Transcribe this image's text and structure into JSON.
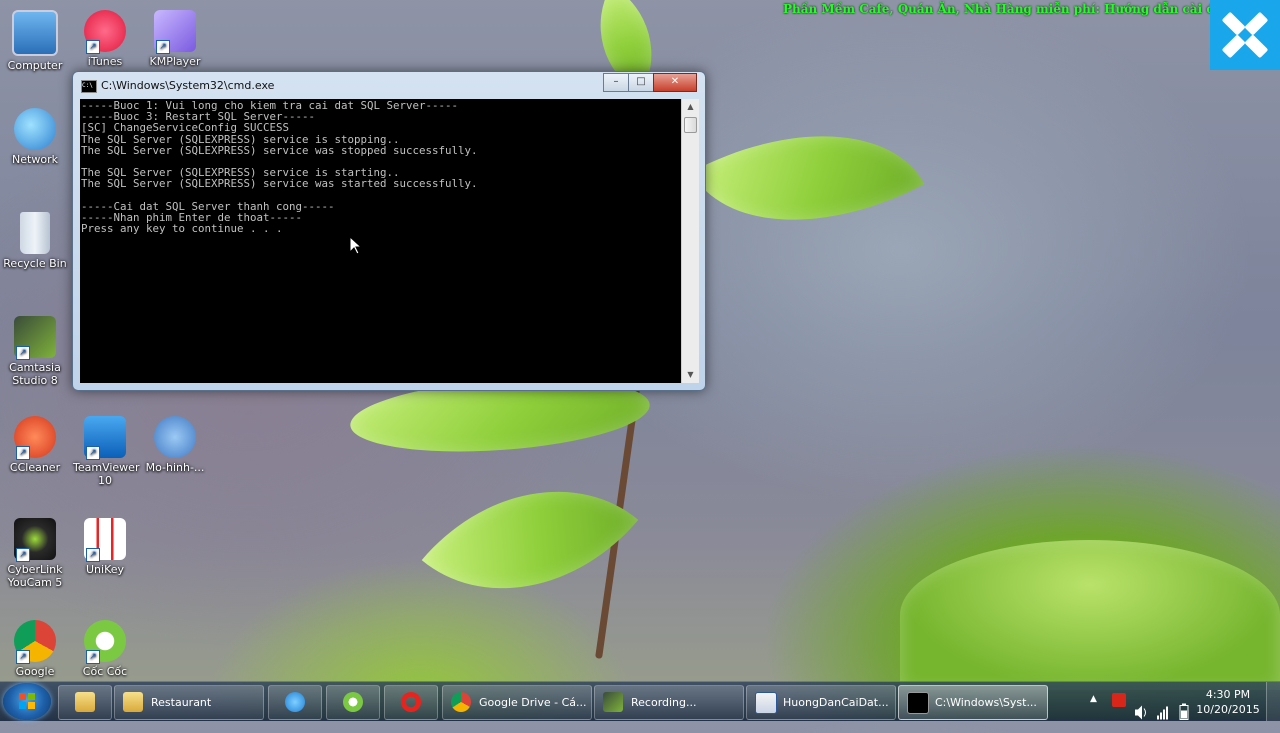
{
  "banner": {
    "text": "Phần Mềm Cafe, Quán Ăn, Nhà Hàng miễn phí: Hướng dẫn cài đặt p"
  },
  "desktop_icons": [
    {
      "label": "Computer"
    },
    {
      "label": "iTunes"
    },
    {
      "label": "KMPlayer"
    },
    {
      "label": "Network"
    },
    {
      "label": "Recycle Bin"
    },
    {
      "label": "Camtasia Studio 8"
    },
    {
      "label": "CCleaner"
    },
    {
      "label": "TeamViewer 10"
    },
    {
      "label": "Mo-hinh-..."
    },
    {
      "label": "CyberLink YouCam 5"
    },
    {
      "label": "UniKey"
    },
    {
      "label": "Google"
    },
    {
      "label": "Cốc Cốc"
    }
  ],
  "cmd_window": {
    "title": "C:\\Windows\\System32\\cmd.exe",
    "icon_text": "C:\\",
    "controls": {
      "minimize": "–",
      "maximize": "□",
      "close": "✕"
    },
    "console_lines": [
      "-----Buoc 1: Vui long cho kiem tra cai dat SQL Server-----",
      "-----Buoc 3: Restart SQL Server-----",
      "[SC] ChangeServiceConfig SUCCESS",
      "The SQL Server (SQLEXPRESS) service is stopping..",
      "The SQL Server (SQLEXPRESS) service was stopped successfully.",
      "",
      "The SQL Server (SQLEXPRESS) service is starting..",
      "The SQL Server (SQLEXPRESS) service was started successfully.",
      "",
      "-----Cai dat SQL Server thanh cong-----",
      "-----Nhan phim Enter de thoat-----",
      "Press any key to continue . . ."
    ],
    "scroll_up": "▲",
    "scroll_down": "▼"
  },
  "taskbar": {
    "buttons": [
      {
        "label": "Restaurant"
      },
      {
        "label": "Google Drive - Cá..."
      },
      {
        "label": "Recording..."
      },
      {
        "label": "HuongDanCaiDat..."
      },
      {
        "label": "C:\\Windows\\Syst..."
      }
    ],
    "tray_up": "▲",
    "clock_time": "4:30 PM",
    "clock_date": "10/20/2015"
  },
  "colors": {
    "console_bg": "#000000",
    "console_text": "#c0c0c0",
    "banner": "#22ff22",
    "accent": "#1aa6ea"
  }
}
